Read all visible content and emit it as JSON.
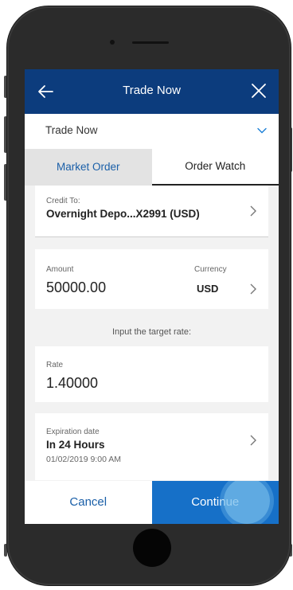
{
  "header": {
    "title": "Trade Now",
    "back_icon": "arrow-left-icon",
    "close_icon": "close-x-icon"
  },
  "dropdown": {
    "selected": "Trade Now"
  },
  "tabs": [
    {
      "label": "Market Order",
      "active": false
    },
    {
      "label": "Order Watch",
      "active": true
    }
  ],
  "credit": {
    "caption": "Credit To:",
    "value": "Overnight Depo...X2991 (USD)"
  },
  "amount": {
    "caption": "Amount",
    "value": "50000.00",
    "currency_caption": "Currency",
    "currency_value": "USD"
  },
  "hint": "Input the target rate:",
  "rate": {
    "caption": "Rate",
    "value": "1.40000"
  },
  "expiry": {
    "caption": "Expiration date",
    "value": "In 24 Hours",
    "datetime": "01/02/2019 9:00 AM"
  },
  "buttons": {
    "cancel": "Cancel",
    "continue": "Continue"
  },
  "colors": {
    "header": "#0c3c7d",
    "accent": "#1670c8",
    "link": "#1a5fa8"
  }
}
